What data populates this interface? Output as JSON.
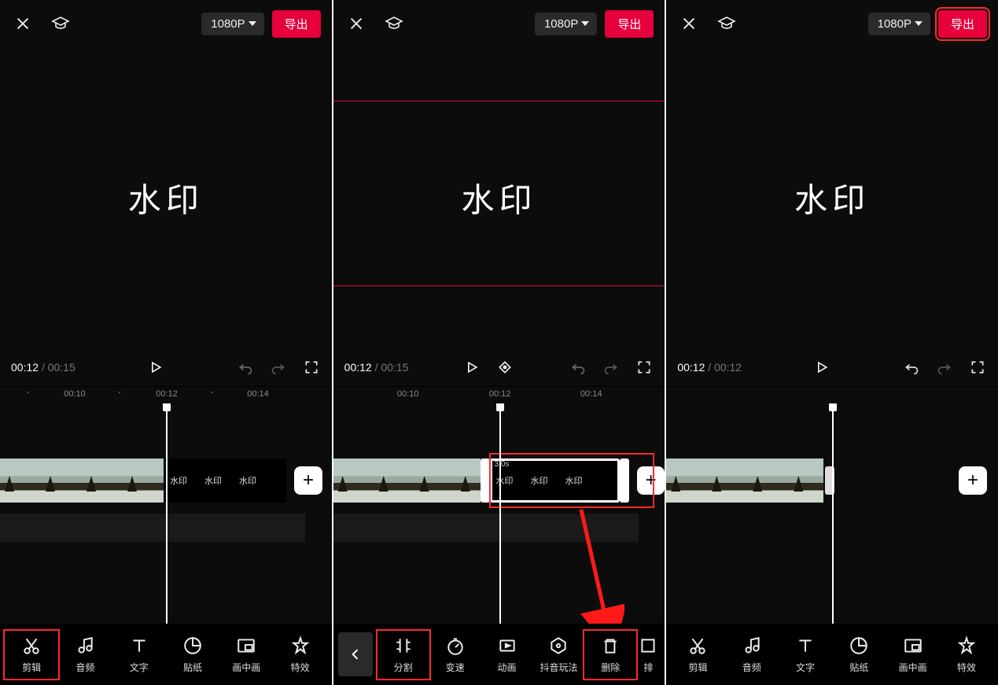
{
  "common": {
    "resolution": "1080P",
    "export_label": "导出",
    "watermark_text": "水印",
    "add_label": "+"
  },
  "panel1": {
    "time_current": "00:12",
    "time_total": "00:15",
    "ruler": [
      "00:10",
      "00:12",
      "00:14"
    ],
    "wm_labels": [
      "水印",
      "水印",
      "水印"
    ],
    "toolbar": [
      {
        "id": "edit",
        "label": "剪辑",
        "highlight": true
      },
      {
        "id": "audio",
        "label": "音频"
      },
      {
        "id": "text",
        "label": "文字"
      },
      {
        "id": "sticker",
        "label": "贴纸"
      },
      {
        "id": "pip",
        "label": "画中画"
      },
      {
        "id": "fx",
        "label": "特效"
      }
    ]
  },
  "panel2": {
    "time_current": "00:12",
    "time_total": "00:15",
    "ruler": [
      "00:10",
      "00:12",
      "00:14"
    ],
    "clip_duration": "3.0s",
    "wm_labels": [
      "水印",
      "水印",
      "水印"
    ],
    "toolbar": [
      {
        "id": "split",
        "label": "分割",
        "highlight": true
      },
      {
        "id": "speed",
        "label": "变速"
      },
      {
        "id": "anim",
        "label": "动画"
      },
      {
        "id": "douyin",
        "label": "抖音玩法"
      },
      {
        "id": "delete",
        "label": "删除",
        "highlight": true
      },
      {
        "id": "more",
        "label": "排"
      }
    ]
  },
  "panel3": {
    "time_current": "00:12",
    "time_total": "00:12",
    "toolbar": [
      {
        "id": "edit",
        "label": "剪辑"
      },
      {
        "id": "audio",
        "label": "音频"
      },
      {
        "id": "text",
        "label": "文字"
      },
      {
        "id": "sticker",
        "label": "贴纸"
      },
      {
        "id": "pip",
        "label": "画中画"
      },
      {
        "id": "fx",
        "label": "特效"
      }
    ],
    "export_highlight": true
  }
}
